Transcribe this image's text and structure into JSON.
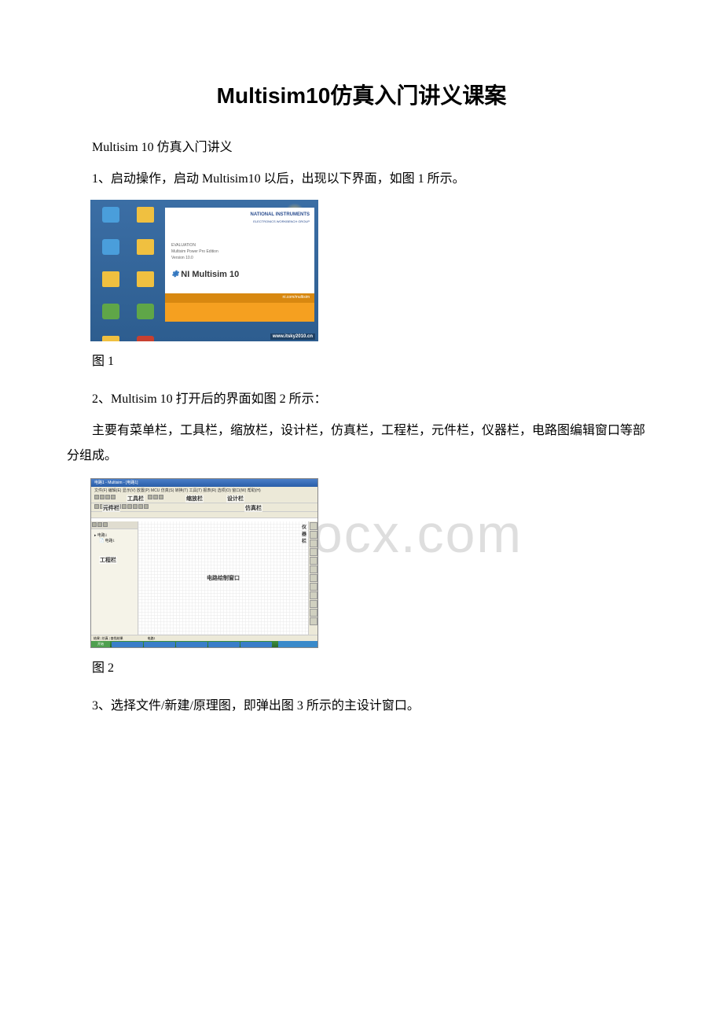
{
  "title": "Multisim10仿真入门讲义课案",
  "para_intro": "Multisim 10 仿真入门讲义",
  "para_1": "1、启动操作，启动 Multisim10 以后，出现以下界面，如图 1 所示。",
  "fig1_label": "图 1",
  "para_2": "2、Multisim 10 打开后的界面如图 2 所示：",
  "para_2b": "主要有菜单栏，工具栏，缩放栏，设计栏，仿真栏，工程栏，元件栏，仪器栏，电路图编辑窗口等部分组成。",
  "fig2_label": "图 2",
  "para_3": "3、选择文件/新建/原理图，即弹出图 3 所示的主设计窗口。",
  "watermark": "w.bdocx.com",
  "fig1": {
    "ni_logo": "NATIONAL INSTRUMENTS",
    "ni_sub": "ELECTRONICS WORKBENCH GROUP",
    "eval": "EVALUATION",
    "edition": "Multisim Power Pro Edition",
    "version": "Version 10.0",
    "brand": "NI Multisim 10",
    "orange_link": "ni.com/multisim",
    "url": "www.itsky2010.cn"
  },
  "fig2": {
    "title": "电路1 - Multisim - [电路1]",
    "menus": "文件(F) 编辑(E) 显示(V) 放置(P) MCU 仿真(S) 转换(T) 工具(T) 报表(R) 选项(O) 窗口(W) 帮助(H)",
    "label_tool": "工具栏",
    "label_zoom": "缩放栏",
    "label_design": "设计栏",
    "label_component": "元件栏",
    "label_sim": "仿真栏",
    "label_project": "工程栏",
    "label_instrument": "仪器栏",
    "label_canvas": "电路绘制窗口",
    "tree_root": "电路1",
    "tree_item": "电路1",
    "bottom_tabs": "结果 | 仿真 | 查找结果",
    "bottom_tab2": "电路1",
    "start": "开始"
  }
}
